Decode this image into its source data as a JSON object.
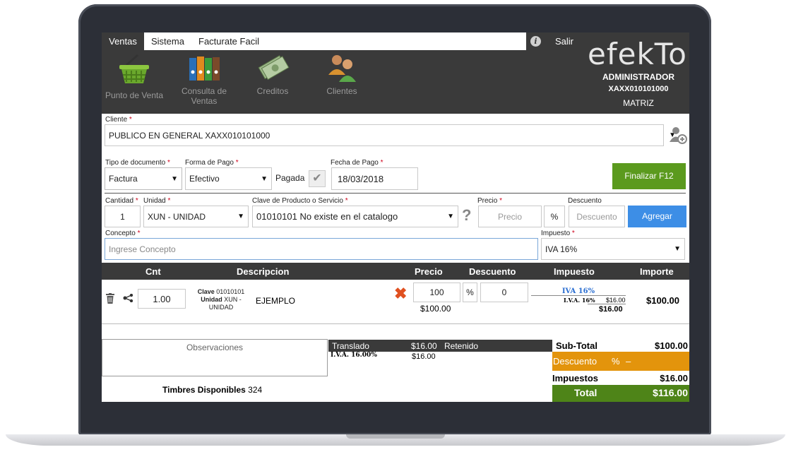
{
  "menu": {
    "ventas": "Ventas",
    "sistema": "Sistema",
    "facturate": "Facturate Facil",
    "info": "i",
    "salir": "Salir"
  },
  "logo": "efekTo",
  "user": {
    "name": "ADMINISTRADOR",
    "rfc": "XAXX010101000",
    "branch": "MATRIZ"
  },
  "toolbar": {
    "punto_venta": "Punto de Venta",
    "consulta_1": "Consulta de",
    "consulta_2": "Ventas",
    "creditos": "Creditos",
    "clientes": "Clientes"
  },
  "form": {
    "cliente_label": "Cliente",
    "cliente_value": "PUBLICO EN GENERAL XAXX010101000",
    "tipo_label": "Tipo de documento",
    "tipo_value": "Factura",
    "forma_label": "Forma de Pago",
    "forma_value": "Efectivo",
    "pagada_label": "Pagada",
    "fecha_label": "Fecha de Pago",
    "fecha_value": "18/03/2018",
    "finalizar": "Finalizar F12",
    "cantidad_label": "Cantidad",
    "cantidad_value": "1",
    "unidad_label": "Unidad",
    "unidad_value": "XUN - UNIDAD",
    "clave_label": "Clave de Producto o Servicio",
    "clave_value": "01010101 No existe en el catalogo",
    "precio_label": "Precio",
    "precio_placeholder": "Precio",
    "pct": "%",
    "descuento_label": "Descuento",
    "descuento_placeholder": "Descuento",
    "agregar": "Agregar",
    "concepto_label": "Concepto",
    "concepto_placeholder": "Ingrese Concepto",
    "impuesto_label": "Impuesto",
    "impuesto_value": "IVA 16%",
    "req": "*"
  },
  "table": {
    "headers": {
      "cnt": "Cnt",
      "descripcion": "Descripcion",
      "precio": "Precio",
      "descuento": "Descuento",
      "impuesto": "Impuesto",
      "importe": "Importe"
    },
    "row": {
      "cantidad": "1.00",
      "clave_label": "Clave",
      "clave_value": "01010101",
      "unidad_label": "Unidad",
      "unidad_value": "XUN -",
      "unidad_value2": "UNIDAD",
      "descripcion": "EJEMPLO",
      "precio": "100",
      "pct": "%",
      "descuento": "0",
      "precio_total": "$100.00",
      "iva_link": "IVA 16%",
      "iva_label": "I.V.A. 16%",
      "iva_amount": "$16.00",
      "iva_total": "$16.00",
      "importe": "$100.00"
    }
  },
  "footer": {
    "observaciones": "Observaciones",
    "timbres_label": "Timbres Disponibles",
    "timbres_value": "324",
    "trasladado": "Translado",
    "trasladado_amount": "$16.00",
    "retenido": "Retenido",
    "iva_detail": "I.V.A. 16.00%",
    "iva_detail_amount": "$16.00",
    "subtotal_label": "Sub-Total",
    "subtotal_value": "$100.00",
    "descuento_label": "Descuento",
    "descuento_pct": "%",
    "descuento_value": "–",
    "impuestos_label": "Impuestos",
    "impuestos_value": "$16.00",
    "total_label": "Total",
    "total_value": "$116.00"
  },
  "colors": {
    "header": "#3a3a3a",
    "finalizar": "#5b9a1e",
    "agregar": "#3d8ee6",
    "descuento": "#e3940c",
    "total": "#4e8418",
    "iva_link": "#2c6fd1"
  }
}
